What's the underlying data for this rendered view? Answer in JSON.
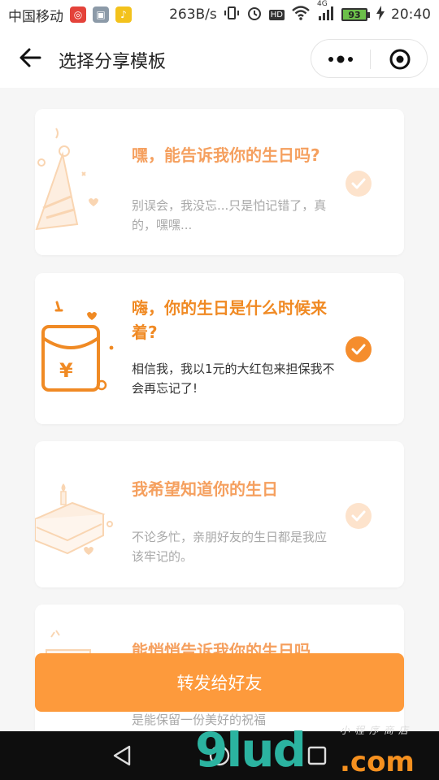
{
  "status_bar": {
    "carrier": "中国移动",
    "speed": "263B/s",
    "hd": "HD",
    "network": "4G",
    "battery": "93",
    "time": "20:40"
  },
  "nav": {
    "title": "选择分享模板"
  },
  "templates": [
    {
      "title": "嘿，能告诉我你的生日吗?",
      "subtitle": "别误会，我没忘...只是怕记错了，真的，嘿嘿...",
      "selected": false,
      "icon": "party-hat-icon"
    },
    {
      "title": "嗨，你的生日是什么时候来着?",
      "subtitle": "相信我，我以1元的大红包来担保我不会再忘记了!",
      "selected": true,
      "icon": "red-envelope-yuan-icon"
    },
    {
      "title": "我希望知道你的生日",
      "subtitle": "不论多忙，亲朋好友的生日都是我应该牢记的。",
      "selected": false,
      "icon": "birthday-cake-icon"
    },
    {
      "title": "能悄悄告诉我你的生日吗",
      "subtitle": "是能保留一份美好的祝福",
      "selected": false,
      "icon": "gift-icon"
    }
  ],
  "share_button": {
    "label": "转发给好友"
  },
  "watermark": {
    "main": "9lud",
    "domain": ".com",
    "cn": "小程序商店"
  },
  "colors": {
    "accent": "#f58d2d",
    "button": "#fd9a3c",
    "title_active": "#f08a24",
    "title_inactive": "#f5a05f"
  }
}
